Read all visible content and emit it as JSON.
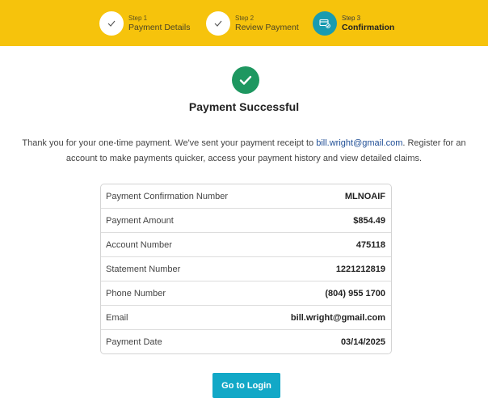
{
  "colors": {
    "header_bg": "#f6c30c",
    "step_current": "#1a9bb0",
    "success_green": "#1e9760",
    "link": "#1f4e96",
    "button_bg": "#12a8c7"
  },
  "steps": [
    {
      "number": "Step 1",
      "label": "Payment Details",
      "status": "complete",
      "icon": "checkmark-icon"
    },
    {
      "number": "Step 2",
      "label": "Review Payment",
      "status": "complete",
      "icon": "checkmark-icon"
    },
    {
      "number": "Step 3",
      "label": "Confirmation",
      "status": "current",
      "icon": "payment-card-icon"
    }
  ],
  "main": {
    "success_icon": "checkmark-circle-icon",
    "title": "Payment Successful",
    "intro_before": "Thank you for your one-time payment. We've sent your payment receipt to ",
    "intro_email": "bill.wright@gmail.com",
    "intro_after": ". Register for an account to make payments quicker, access your payment history and view detailed claims."
  },
  "details": [
    {
      "label": "Payment Confirmation Number",
      "value": "MLNOAIF"
    },
    {
      "label": "Payment Amount",
      "value": "$854.49"
    },
    {
      "label": "Account Number",
      "value": "475118"
    },
    {
      "label": "Statement Number",
      "value": "1221212819"
    },
    {
      "label": "Phone Number",
      "value": "(804) 955 1700"
    },
    {
      "label": "Email",
      "value": "bill.wright@gmail.com"
    },
    {
      "label": "Payment Date",
      "value": "03/14/2025"
    }
  ],
  "actions": {
    "login_label": "Go to Login"
  }
}
